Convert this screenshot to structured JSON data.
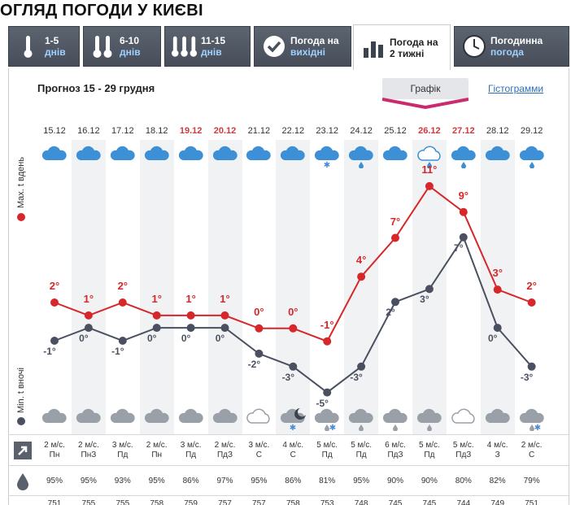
{
  "page": {
    "title": "ОГЛЯД ПОГОДИ У КИЄВІ"
  },
  "tabs": [
    {
      "line1": "1-5",
      "line2": "днів",
      "icon": "thermometer-1-icon",
      "active": false
    },
    {
      "line1": "6-10",
      "line2": "днів",
      "icon": "thermometer-2-icon",
      "active": false
    },
    {
      "line1": "11-15",
      "line2": "днів",
      "icon": "thermometer-3-icon",
      "active": false
    },
    {
      "line1": "Погода на",
      "line2": "вихідні",
      "icon": "checkmark-icon",
      "active": false
    },
    {
      "line1": "Погода на",
      "line2": "2 тижні",
      "icon": "bar-chart-icon",
      "active": true
    },
    {
      "line1": "Погодинна",
      "line2": "погода",
      "icon": "clock-icon",
      "active": false
    }
  ],
  "forecast": {
    "title": "Прогноз 15 - 29 грудня",
    "view_chart_label": "Графік",
    "view_histogram_label": "Гістограмми",
    "axis_day_label": "Max. t вдень",
    "axis_night_label": "Min. t вночі",
    "day_color": "#d6272a",
    "night_color": "#4a5060"
  },
  "days": [
    {
      "date": "15.12",
      "weekend": false,
      "day_icon": "cloud-icon",
      "night_icon": "cloud-icon",
      "tmax": 2,
      "tmax_label": "2°",
      "tmin": -1,
      "tmin_label": "-1°",
      "wind_speed": "2 м/с.",
      "wind_dir": "Пн",
      "humidity": "95%",
      "pressure": "751"
    },
    {
      "date": "16.12",
      "weekend": false,
      "day_icon": "cloud-icon",
      "night_icon": "cloud-icon",
      "tmax": 1,
      "tmax_label": "1°",
      "tmin": 0,
      "tmin_label": "0°",
      "wind_speed": "2 м/с.",
      "wind_dir": "ПнЗ",
      "humidity": "95%",
      "pressure": "755"
    },
    {
      "date": "17.12",
      "weekend": false,
      "day_icon": "cloud-icon",
      "night_icon": "cloud-icon",
      "tmax": 2,
      "tmax_label": "2°",
      "tmin": -1,
      "tmin_label": "-1°",
      "wind_speed": "3 м/с.",
      "wind_dir": "Пд",
      "humidity": "93%",
      "pressure": "755"
    },
    {
      "date": "18.12",
      "weekend": false,
      "day_icon": "cloud-icon",
      "night_icon": "cloud-icon",
      "tmax": 1,
      "tmax_label": "1°",
      "tmin": 0,
      "tmin_label": "0°",
      "wind_speed": "2 м/с.",
      "wind_dir": "Пн",
      "humidity": "95%",
      "pressure": "758"
    },
    {
      "date": "19.12",
      "weekend": true,
      "day_icon": "cloud-icon",
      "night_icon": "cloud-icon",
      "tmax": 1,
      "tmax_label": "1°",
      "tmin": 0,
      "tmin_label": "0°",
      "wind_speed": "3 м/с.",
      "wind_dir": "Пд",
      "humidity": "86%",
      "pressure": "759"
    },
    {
      "date": "20.12",
      "weekend": true,
      "day_icon": "cloud-icon",
      "night_icon": "cloud-icon",
      "tmax": 1,
      "tmax_label": "1°",
      "tmin": 0,
      "tmin_label": "0°",
      "wind_speed": "2 м/с.",
      "wind_dir": "ПдЗ",
      "humidity": "97%",
      "pressure": "757"
    },
    {
      "date": "21.12",
      "weekend": false,
      "day_icon": "cloud-icon",
      "night_icon": "light-cloud-icon",
      "tmax": 0,
      "tmax_label": "0°",
      "tmin": -2,
      "tmin_label": "-2°",
      "wind_speed": "3 м/с.",
      "wind_dir": "С",
      "humidity": "95%",
      "pressure": "757"
    },
    {
      "date": "22.12",
      "weekend": false,
      "day_icon": "cloud-icon",
      "night_icon": "cloud-moon-snow-icon",
      "tmax": 0,
      "tmax_label": "0°",
      "tmin": -3,
      "tmin_label": "-3°",
      "wind_speed": "4 м/с.",
      "wind_dir": "С",
      "humidity": "86%",
      "pressure": "758"
    },
    {
      "date": "23.12",
      "weekend": false,
      "day_icon": "cloud-snow-icon",
      "night_icon": "cloud-rain-snow-icon",
      "tmax": -1,
      "tmax_label": "-1°",
      "tmin": -5,
      "tmin_label": "-5°",
      "wind_speed": "5 м/с.",
      "wind_dir": "Пд",
      "humidity": "81%",
      "pressure": "753"
    },
    {
      "date": "24.12",
      "weekend": false,
      "day_icon": "cloud-rain-icon",
      "night_icon": "cloud-rain-icon",
      "tmax": 4,
      "tmax_label": "4°",
      "tmin": -3,
      "tmin_label": "-3°",
      "wind_speed": "5 м/с.",
      "wind_dir": "Пд",
      "humidity": "95%",
      "pressure": "748"
    },
    {
      "date": "25.12",
      "weekend": false,
      "day_icon": "cloud-icon",
      "night_icon": "cloud-rain-icon",
      "tmax": 7,
      "tmax_label": "7°",
      "tmin": 2,
      "tmin_label": "2°",
      "wind_speed": "6 м/с.",
      "wind_dir": "ПдЗ",
      "humidity": "90%",
      "pressure": "745"
    },
    {
      "date": "26.12",
      "weekend": true,
      "day_icon": "light-cloud-rain-icon",
      "night_icon": "cloud-rain-icon",
      "tmax": 11,
      "tmax_label": "11°",
      "tmin": 3,
      "tmin_label": "3°",
      "wind_speed": "5 м/с.",
      "wind_dir": "Пд",
      "humidity": "90%",
      "pressure": "745"
    },
    {
      "date": "27.12",
      "weekend": true,
      "day_icon": "cloud-rain-icon",
      "night_icon": "light-cloud-icon",
      "tmax": 9,
      "tmax_label": "9°",
      "tmin": 7,
      "tmin_label": "7°",
      "wind_speed": "5 м/с.",
      "wind_dir": "ПдЗ",
      "humidity": "80%",
      "pressure": "744"
    },
    {
      "date": "28.12",
      "weekend": false,
      "day_icon": "cloud-icon",
      "night_icon": "cloud-icon",
      "tmax": 3,
      "tmax_label": "3°",
      "tmin": 0,
      "tmin_label": "0°",
      "wind_speed": "4 м/с.",
      "wind_dir": "З",
      "humidity": "82%",
      "pressure": "749"
    },
    {
      "date": "29.12",
      "weekend": false,
      "day_icon": "cloud-rain-icon",
      "night_icon": "cloud-rain-snow-icon",
      "tmax": 2,
      "tmax_label": "2°",
      "tmin": -3,
      "tmin_label": "-3°",
      "wind_speed": "2 м/с.",
      "wind_dir": "С",
      "humidity": "79%",
      "pressure": "751"
    }
  ],
  "rows": {
    "wind_icon": "wind-arrow-icon",
    "humidity_icon": "droplet-icon"
  }
}
